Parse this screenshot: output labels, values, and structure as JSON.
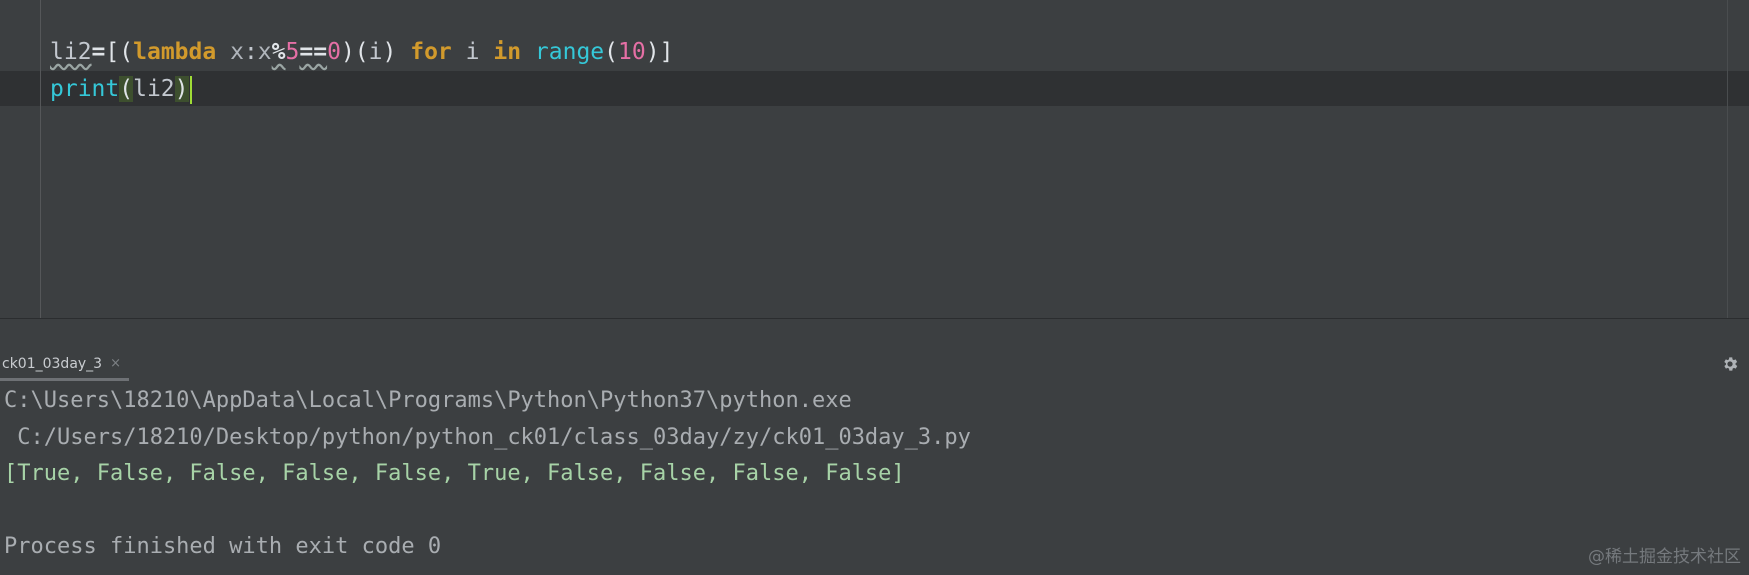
{
  "editor": {
    "line1": {
      "var": "li2",
      "eq": "=",
      "open_list": "[",
      "open_paren": "(",
      "lambda_kw": "lambda",
      "space": " ",
      "param": "x",
      "colon": ":",
      "x": "x",
      "mod": "%",
      "five": "5",
      "eqeq": "==",
      "zero": "0",
      "close_paren": ")",
      "call_open": "(",
      "i_arg": "i",
      "call_close": ")",
      "for_kw": "for",
      "loop_var": "i",
      "in_kw": "in",
      "range": "range",
      "range_open": "(",
      "ten": "10",
      "range_close": ")",
      "close_list": "]"
    },
    "line2": {
      "print": "print",
      "open": "(",
      "arg": "li2",
      "close": ")"
    }
  },
  "run_panel": {
    "tab_label": "ck01_03day_3",
    "tab_close": "×",
    "settings_icon": "gear-icon",
    "output": [
      "C:\\Users\\18210\\AppData\\Local\\Programs\\Python\\Python37\\python.exe",
      " C:/Users/18210/Desktop/python/python_ck01/class_03day/zy/ck01_03day_3.py",
      "[True, False, False, False, False, True, False, False, False, False]",
      "",
      "Process finished with exit code 0"
    ]
  },
  "watermark": "@稀土掘金技术社区",
  "colors": {
    "background": "#3c3f41",
    "keyword": "#d29a2c",
    "number": "#e56fa5",
    "builtin": "#35c8d8",
    "output_result": "#a7d3a7"
  }
}
